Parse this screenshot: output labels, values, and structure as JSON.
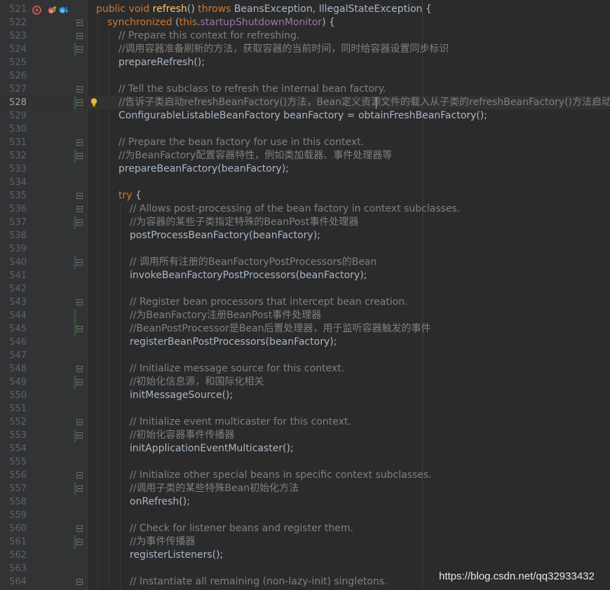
{
  "editor": {
    "lines": [
      {
        "n": "521",
        "indent": 0,
        "parts": [
          [
            "kw",
            "public void "
          ],
          [
            "fn",
            "refresh"
          ],
          [
            "p",
            "() "
          ],
          [
            "kw",
            "throws "
          ],
          [
            "p",
            "BeansException, IllegalStateException {"
          ]
        ]
      },
      {
        "n": "522",
        "indent": 1,
        "parts": [
          [
            "kw",
            "synchronized "
          ],
          [
            "p",
            "("
          ],
          [
            "kw",
            "this"
          ],
          [
            "p",
            "."
          ],
          [
            "field",
            "startupShutdownMonitor"
          ],
          [
            "p",
            ") {"
          ]
        ]
      },
      {
        "n": "523",
        "indent": 2,
        "parts": [
          [
            "cmt",
            "// Prepare this context for refreshing."
          ]
        ]
      },
      {
        "n": "524",
        "indent": 2,
        "parts": [
          [
            "cmt",
            "//调用容器准备刷新的方法，获取容器的当前时间，同时给容器设置同步标识"
          ]
        ]
      },
      {
        "n": "525",
        "indent": 2,
        "parts": [
          [
            "p",
            "prepareRefresh();"
          ]
        ]
      },
      {
        "n": "526",
        "indent": 0,
        "parts": []
      },
      {
        "n": "527",
        "indent": 2,
        "parts": [
          [
            "cmt",
            "// Tell the subclass to refresh the internal bean factory."
          ]
        ]
      },
      {
        "n": "528",
        "indent": 2,
        "parts": [
          [
            "cmt",
            "//告诉子类启动refreshBeanFactory()方法，Bean定义资源文件的载入从子类的refreshBeanFactory()方法启动"
          ]
        ]
      },
      {
        "n": "529",
        "indent": 2,
        "parts": [
          [
            "p",
            "ConfigurableListableBeanFactory beanFactory = obtainFreshBeanFactory();"
          ]
        ]
      },
      {
        "n": "530",
        "indent": 0,
        "parts": []
      },
      {
        "n": "531",
        "indent": 2,
        "parts": [
          [
            "cmt",
            "// Prepare the bean factory for use in this context."
          ]
        ]
      },
      {
        "n": "532",
        "indent": 2,
        "parts": [
          [
            "cmt",
            "//为BeanFactory配置容器特性，例如类加载器、事件处理器等"
          ]
        ]
      },
      {
        "n": "533",
        "indent": 2,
        "parts": [
          [
            "p",
            "prepareBeanFactory(beanFactory);"
          ]
        ]
      },
      {
        "n": "534",
        "indent": 0,
        "parts": []
      },
      {
        "n": "535",
        "indent": 2,
        "parts": [
          [
            "kw",
            "try "
          ],
          [
            "p",
            "{"
          ]
        ]
      },
      {
        "n": "536",
        "indent": 3,
        "parts": [
          [
            "cmt",
            "// Allows post-processing of the bean factory in context subclasses."
          ]
        ]
      },
      {
        "n": "537",
        "indent": 3,
        "parts": [
          [
            "cmt",
            "//为容器的某些子类指定特殊的BeanPost事件处理器"
          ]
        ]
      },
      {
        "n": "538",
        "indent": 3,
        "parts": [
          [
            "p",
            "postProcessBeanFactory(beanFactory);"
          ]
        ]
      },
      {
        "n": "539",
        "indent": 0,
        "parts": []
      },
      {
        "n": "540",
        "indent": 3,
        "parts": [
          [
            "cmt",
            "// 调用所有注册的BeanFactoryPostProcessors的Bean"
          ]
        ]
      },
      {
        "n": "541",
        "indent": 3,
        "parts": [
          [
            "p",
            "invokeBeanFactoryPostProcessors(beanFactory);"
          ]
        ]
      },
      {
        "n": "542",
        "indent": 0,
        "parts": []
      },
      {
        "n": "543",
        "indent": 3,
        "parts": [
          [
            "cmt",
            "// Register bean processors that intercept bean creation."
          ]
        ]
      },
      {
        "n": "544",
        "indent": 3,
        "parts": [
          [
            "cmt",
            "//为BeanFactory注册BeanPost事件处理器"
          ]
        ]
      },
      {
        "n": "545",
        "indent": 3,
        "parts": [
          [
            "cmt",
            "//BeanPostProcessor是Bean后置处理器，用于监听容器触发的事件"
          ]
        ]
      },
      {
        "n": "546",
        "indent": 3,
        "parts": [
          [
            "p",
            "registerBeanPostProcessors(beanFactory);"
          ]
        ]
      },
      {
        "n": "547",
        "indent": 0,
        "parts": []
      },
      {
        "n": "548",
        "indent": 3,
        "parts": [
          [
            "cmt",
            "// Initialize message source for this context."
          ]
        ]
      },
      {
        "n": "549",
        "indent": 3,
        "parts": [
          [
            "cmt",
            "//初始化信息源，和国际化相关"
          ]
        ]
      },
      {
        "n": "550",
        "indent": 3,
        "parts": [
          [
            "p",
            "initMessageSource();"
          ]
        ]
      },
      {
        "n": "551",
        "indent": 0,
        "parts": []
      },
      {
        "n": "552",
        "indent": 3,
        "parts": [
          [
            "cmt",
            "// Initialize event multicaster for this context."
          ]
        ]
      },
      {
        "n": "553",
        "indent": 3,
        "parts": [
          [
            "cmt",
            "//初始化容器事件传播器"
          ]
        ]
      },
      {
        "n": "554",
        "indent": 3,
        "parts": [
          [
            "p",
            "initApplicationEventMulticaster();"
          ]
        ]
      },
      {
        "n": "555",
        "indent": 0,
        "parts": []
      },
      {
        "n": "556",
        "indent": 3,
        "parts": [
          [
            "cmt",
            "// Initialize other special beans in specific context subclasses."
          ]
        ]
      },
      {
        "n": "557",
        "indent": 3,
        "parts": [
          [
            "cmt",
            "//调用子类的某些特殊Bean初始化方法"
          ]
        ]
      },
      {
        "n": "558",
        "indent": 3,
        "parts": [
          [
            "p",
            "onRefresh();"
          ]
        ]
      },
      {
        "n": "559",
        "indent": 0,
        "parts": []
      },
      {
        "n": "560",
        "indent": 3,
        "parts": [
          [
            "cmt",
            "// Check for listener beans and register them."
          ]
        ]
      },
      {
        "n": "561",
        "indent": 3,
        "parts": [
          [
            "cmt",
            "//为事件传播器"
          ]
        ]
      },
      {
        "n": "562",
        "indent": 3,
        "parts": [
          [
            "p",
            "registerListeners();"
          ]
        ]
      },
      {
        "n": "563",
        "indent": 0,
        "parts": []
      },
      {
        "n": "564",
        "indent": 3,
        "parts": [
          [
            "cmt",
            "// Instantiate all remaining (non-lazy-init) singletons."
          ]
        ]
      }
    ],
    "current_line": "528",
    "fold_lines": [
      "522",
      "523",
      "524",
      "527",
      "528",
      "531",
      "532",
      "535",
      "536",
      "537",
      "540",
      "543",
      "545",
      "548",
      "549",
      "552",
      "553",
      "556",
      "557",
      "560",
      "561",
      "564"
    ],
    "added_lines": [
      "524",
      "528",
      "532",
      "537",
      "544",
      "545",
      "549",
      "553",
      "557",
      "561"
    ],
    "modified_lines": [
      "540"
    ],
    "gutter_icons": [
      {
        "line": "521",
        "name": "recursion-icon"
      },
      {
        "line": "521",
        "name": "override-up-icon"
      },
      {
        "line": "521",
        "name": "override-down-icon"
      }
    ],
    "intention_bulb_line": "528"
  },
  "colors": {
    "background": "#2b2b2b",
    "keyword": "#cc7832",
    "method": "#ffc66d",
    "field": "#9876aa",
    "comment": "#808080",
    "plain": "#a9b7c6"
  },
  "watermark": "https://blog.csdn.net/qq32933432"
}
